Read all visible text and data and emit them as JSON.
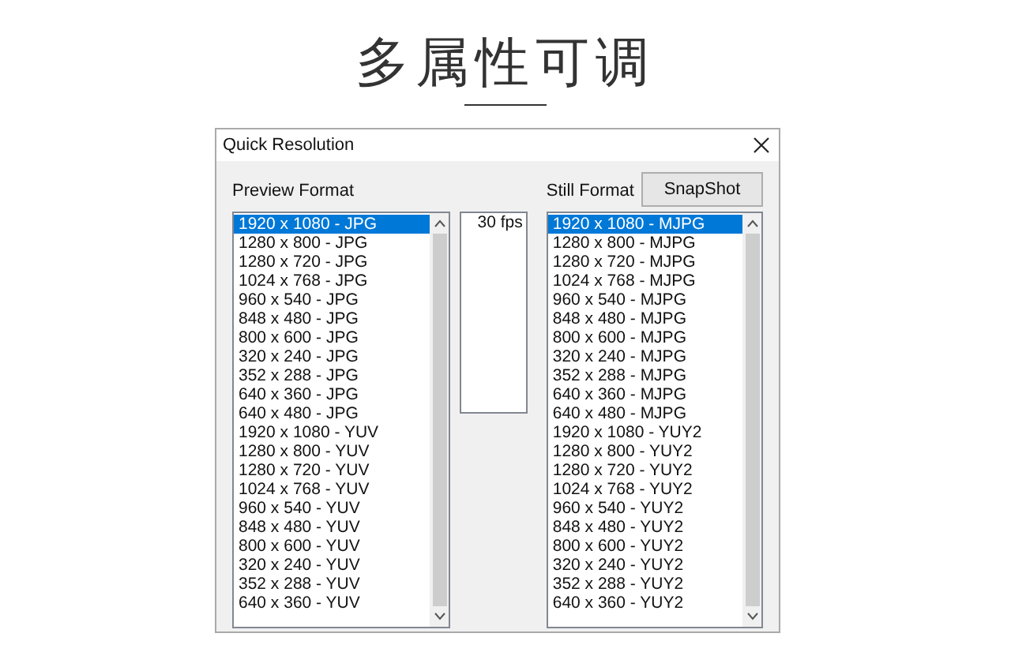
{
  "heading": "多属性可调",
  "dialog": {
    "title": "Quick Resolution",
    "preview_format": {
      "label": "Preview Format",
      "items": [
        {
          "label": "1920 x 1080 - JPG",
          "selected": true
        },
        {
          "label": "1280 x 800 - JPG",
          "selected": false
        },
        {
          "label": "1280 x 720 - JPG",
          "selected": false
        },
        {
          "label": "1024 x 768 - JPG",
          "selected": false
        },
        {
          "label": "960 x 540 - JPG",
          "selected": false
        },
        {
          "label": "848 x 480 - JPG",
          "selected": false
        },
        {
          "label": "800 x 600 - JPG",
          "selected": false
        },
        {
          "label": "320 x 240 - JPG",
          "selected": false
        },
        {
          "label": "352 x 288 - JPG",
          "selected": false
        },
        {
          "label": "640 x 360 - JPG",
          "selected": false
        },
        {
          "label": "640 x 480 - JPG",
          "selected": false
        },
        {
          "label": "1920 x 1080 - YUV",
          "selected": false
        },
        {
          "label": "1280 x 800 - YUV",
          "selected": false
        },
        {
          "label": "1280 x 720 - YUV",
          "selected": false
        },
        {
          "label": "1024 x 768 - YUV",
          "selected": false
        },
        {
          "label": "960 x 540 - YUV",
          "selected": false
        },
        {
          "label": "848 x 480 - YUV",
          "selected": false
        },
        {
          "label": "800 x 600 - YUV",
          "selected": false
        },
        {
          "label": "320 x 240 - YUV",
          "selected": false
        },
        {
          "label": "352 x 288 - YUV",
          "selected": false
        },
        {
          "label": "640 x 360 - YUV",
          "selected": false
        }
      ]
    },
    "frame_rate": {
      "items": [
        "30 fps"
      ]
    },
    "still_format": {
      "label": "Still Format",
      "button": "SnapShot",
      "items": [
        {
          "label": "1920 x 1080 - MJPG",
          "selected": true
        },
        {
          "label": "1280 x 800 - MJPG",
          "selected": false
        },
        {
          "label": "1280 x 720 - MJPG",
          "selected": false
        },
        {
          "label": "1024 x 768 - MJPG",
          "selected": false
        },
        {
          "label": "960 x 540 - MJPG",
          "selected": false
        },
        {
          "label": "848 x 480 - MJPG",
          "selected": false
        },
        {
          "label": "800 x 600 - MJPG",
          "selected": false
        },
        {
          "label": "320 x 240 - MJPG",
          "selected": false
        },
        {
          "label": "352 x 288 - MJPG",
          "selected": false
        },
        {
          "label": "640 x 360 - MJPG",
          "selected": false
        },
        {
          "label": "640 x 480 - MJPG",
          "selected": false
        },
        {
          "label": "1920 x 1080 - YUY2",
          "selected": false
        },
        {
          "label": "1280 x 800 - YUY2",
          "selected": false
        },
        {
          "label": "1280 x 720 - YUY2",
          "selected": false
        },
        {
          "label": "1024 x 768 - YUY2",
          "selected": false
        },
        {
          "label": "960 x 540 - YUY2",
          "selected": false
        },
        {
          "label": "848 x 480 - YUY2",
          "selected": false
        },
        {
          "label": "800 x 600 - YUY2",
          "selected": false
        },
        {
          "label": "320 x 240 - YUY2",
          "selected": false
        },
        {
          "label": "352 x 288 - YUY2",
          "selected": false
        },
        {
          "label": "640 x 360 - YUY2",
          "selected": false
        }
      ]
    }
  }
}
